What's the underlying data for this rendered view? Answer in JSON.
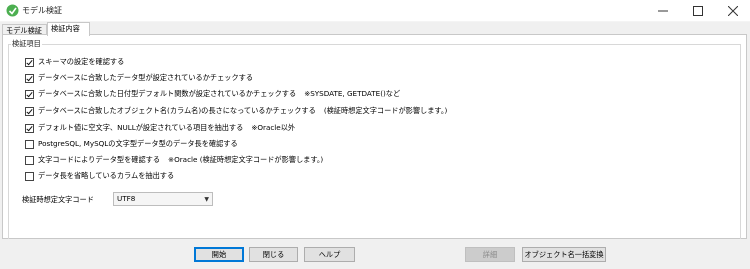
{
  "window": {
    "title": "モデル検証",
    "icon": "app-icon",
    "controls": {
      "minimize": "—",
      "maximize": "☐",
      "close": "✕"
    }
  },
  "tabs": [
    {
      "label": "モデル検証",
      "selected": false
    },
    {
      "label": "検証内容",
      "selected": true
    }
  ],
  "group": {
    "legend": "検証項目",
    "items": [
      {
        "label": "スキーマの設定を確認する",
        "note": "",
        "checked": true
      },
      {
        "label": "データベースに合致したデータ型が設定されているかチェックする",
        "note": "",
        "checked": true
      },
      {
        "label": "データベースに合致した日付型デフォルト関数が設定されているかチェックする",
        "note": "※SYSDATE, GETDATE()など",
        "checked": true
      },
      {
        "label": "データベースに合致したオブジェクト名(カラム名)の長さになっているかチェックする",
        "note": "(検証時想定文字コードが影響します。)",
        "checked": true
      },
      {
        "label": "デフォルト値に空文字、NULLが設定されている項目を抽出する",
        "note": "※Oracle以外",
        "checked": true
      },
      {
        "label": "PostgreSQL, MySQLの文字型データ型のデータ長を確認する",
        "note": "",
        "checked": false
      },
      {
        "label": "文字コードによりデータ型を確認する",
        "note": "※Oracle (検証時想定文字コードが影響します。)",
        "checked": false
      },
      {
        "label": "データ長を省略しているカラムを抽出する",
        "note": "",
        "checked": false
      }
    ]
  },
  "encoding": {
    "label": "検証時想定文字コード",
    "value": "UTF8"
  },
  "buttons": {
    "start": "開始",
    "close": "閉じる",
    "help": "ヘルプ",
    "details": "詳細",
    "replace": "オブジェクト名一括変換"
  }
}
